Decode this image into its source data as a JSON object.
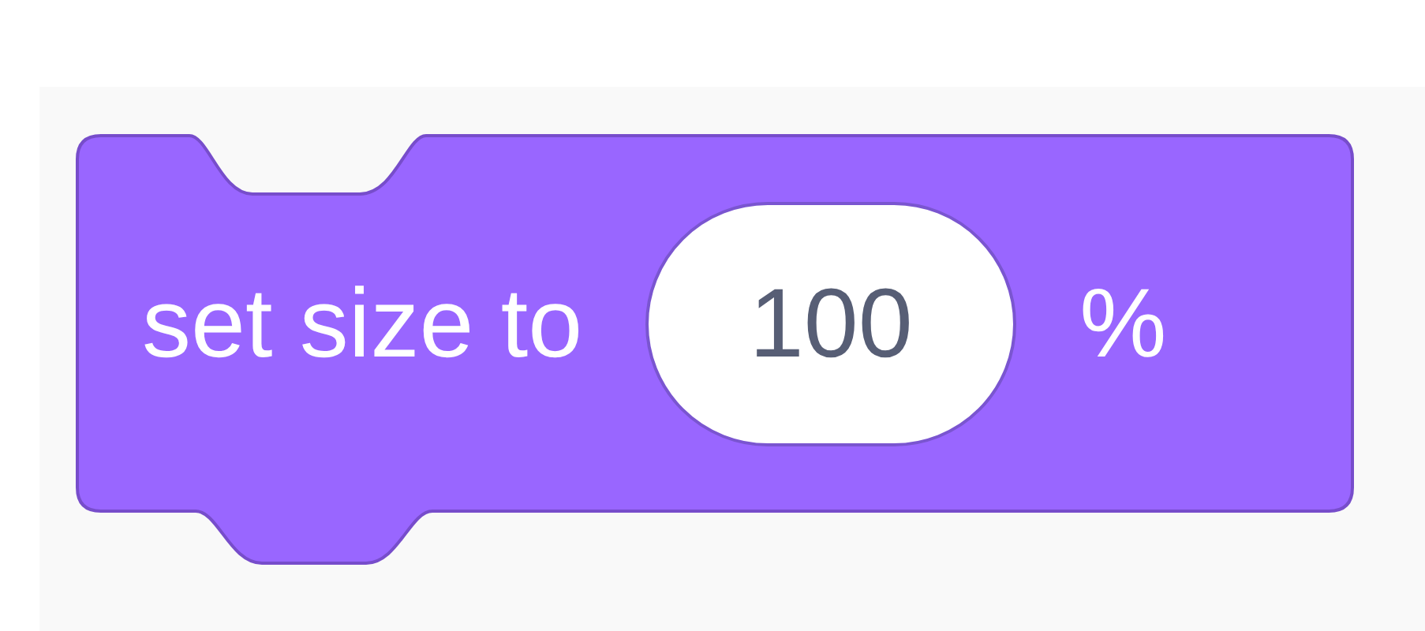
{
  "block": {
    "label": "set size to",
    "input": "100",
    "unit": "%"
  }
}
